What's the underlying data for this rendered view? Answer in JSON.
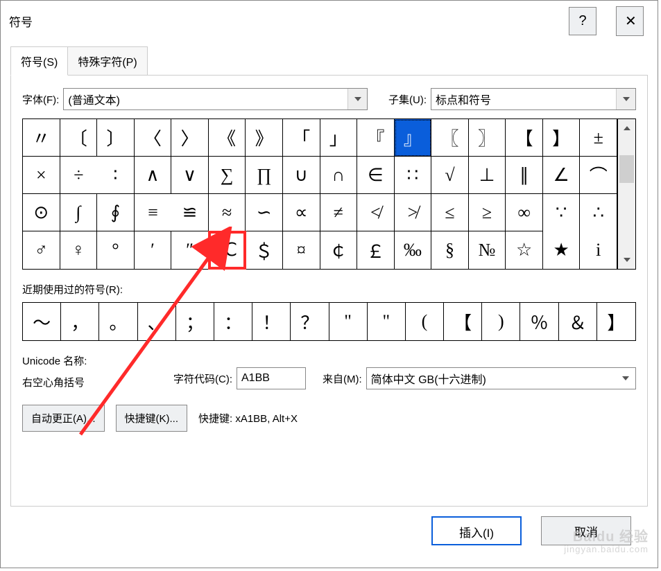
{
  "window": {
    "title": "符号"
  },
  "tabs": {
    "symbols": "符号(S)",
    "special": "特殊字符(P)"
  },
  "font": {
    "label": "字体(F):",
    "value": "(普通文本)"
  },
  "subset": {
    "label": "子集(U):",
    "value": "标点和符号"
  },
  "grid": [
    "〃",
    "〔",
    "〕",
    "〈",
    "〉",
    "《",
    "》",
    "「",
    "」",
    "『",
    "』",
    "〖",
    "〗",
    "【",
    "】",
    "±",
    "×",
    "÷",
    "∶",
    "∧",
    "∨",
    "∑",
    "∏",
    "∪",
    "∩",
    "∈",
    "∷",
    "√",
    "⊥",
    "∥",
    "∠",
    "⌒",
    "⊙",
    "∫",
    "∮",
    "≡",
    "≌",
    "≈",
    "∽",
    "∝",
    "≠",
    "≮",
    "≯",
    "≤",
    "≥",
    "∞",
    "∵",
    "∴",
    "♂",
    "♀",
    "°",
    "′",
    "″",
    "℃",
    "＄",
    "¤",
    "￠",
    "￡",
    "‰",
    "§",
    "№",
    "☆",
    "★",
    "i"
  ],
  "grid_highlight_index": 53,
  "grid_selected_index": 10,
  "recent_label": "近期使用过的符号(R):",
  "recent": [
    "～",
    "，",
    "。",
    "、",
    "；",
    "：",
    "！",
    "？",
    "\"",
    "\"",
    "(",
    "【",
    ")",
    "％",
    "＆",
    "】"
  ],
  "unicode_name_label": "Unicode 名称:",
  "unicode_name": "右空心角括号",
  "char_code_label": "字符代码(C):",
  "char_code": "A1BB",
  "from_label": "来自(M):",
  "from_value": "简体中文 GB(十六进制)",
  "buttons": {
    "autocorrect": "自动更正(A)...",
    "shortcut": "快捷键(K)...",
    "shortcut_label": "快捷键: xA1BB, Alt+X",
    "insert": "插入(I)",
    "cancel": "取消"
  },
  "watermark": {
    "l1": "Baidu 经验",
    "l2": "jingyan.baidu.com"
  }
}
